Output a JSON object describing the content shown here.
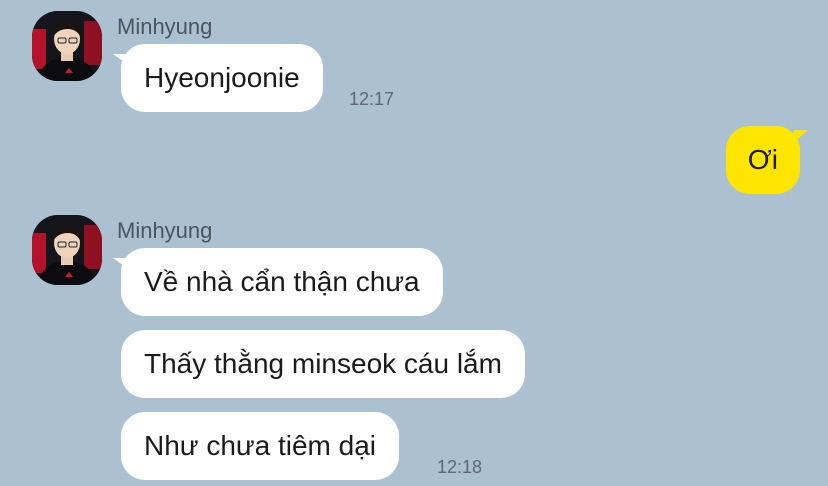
{
  "groups": [
    {
      "sender": "Minhyung",
      "messages": [
        "Hyeonjoonie"
      ],
      "time": "12:17"
    },
    {
      "me": true,
      "messages": [
        "Ơi"
      ]
    },
    {
      "sender": "Minhyung",
      "messages": [
        "Về nhà cẩn thận chưa",
        "Thấy thằng minseok cáu lắm",
        "Như chưa tiêm dại"
      ],
      "time": "12:18"
    }
  ],
  "colors": {
    "background": "#abc1d1",
    "incoming_bubble": "#ffffff",
    "outgoing_bubble": "#fee500"
  },
  "icons": {
    "avatar": "profile-photo"
  }
}
